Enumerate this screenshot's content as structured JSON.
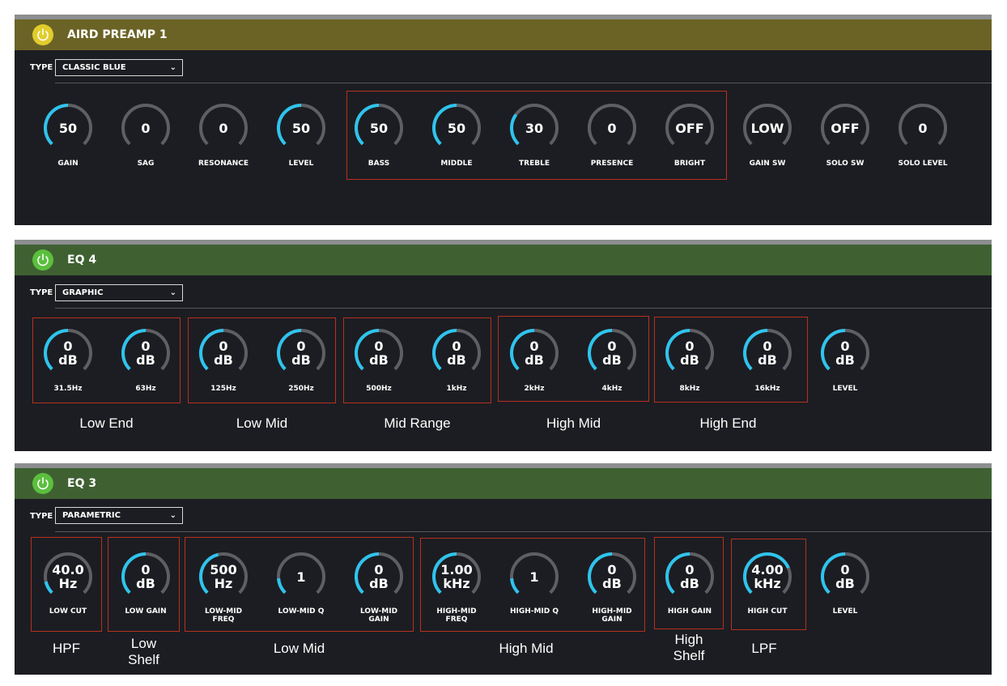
{
  "colors": {
    "panel_bg": "#1c1d22",
    "arc_track": "#5e5f63",
    "arc_value": "#2ec4ee",
    "group_border": "#b5301f",
    "preamp_header": "#6b6325",
    "eq_header": "#3f6132",
    "preamp_power": "#e2cc2c",
    "eq_power": "#5bbf3d"
  },
  "panels": [
    {
      "title": "AIRD PREAMP 1",
      "type_label": "TYPE",
      "type_value": "CLASSIC BLUE",
      "power_icon": "power-icon",
      "knobs": [
        {
          "value": "50",
          "label": "GAIN",
          "level": 0.5
        },
        {
          "value": "0",
          "label": "SAG",
          "level": 0.0
        },
        {
          "value": "0",
          "label": "RESONANCE",
          "level": 0.0
        },
        {
          "value": "50",
          "label": "LEVEL",
          "level": 0.5
        },
        {
          "value": "50",
          "label": "BASS",
          "level": 0.5
        },
        {
          "value": "50",
          "label": "MIDDLE",
          "level": 0.5
        },
        {
          "value": "30",
          "label": "TREBLE",
          "level": 0.3
        },
        {
          "value": "0",
          "label": "PRESENCE",
          "level": 0.0
        },
        {
          "value": "OFF",
          "label": "BRIGHT",
          "level": 0.0
        },
        {
          "value": "LOW",
          "label": "GAIN SW",
          "level": 0.0
        },
        {
          "value": "OFF",
          "label": "SOLO SW",
          "level": 0.0
        },
        {
          "value": "0",
          "label": "SOLO LEVEL",
          "level": 0.0
        }
      ],
      "groups": []
    },
    {
      "title": "EQ 4",
      "type_label": "TYPE",
      "type_value": "GRAPHIC",
      "power_icon": "power-icon",
      "knobs": [
        {
          "value": "0\ndB",
          "label": "31.5Hz",
          "level": 0.5
        },
        {
          "value": "0\ndB",
          "label": "63Hz",
          "level": 0.5
        },
        {
          "value": "0\ndB",
          "label": "125Hz",
          "level": 0.5
        },
        {
          "value": "0\ndB",
          "label": "250Hz",
          "level": 0.5
        },
        {
          "value": "0\ndB",
          "label": "500Hz",
          "level": 0.5
        },
        {
          "value": "0\ndB",
          "label": "1kHz",
          "level": 0.5
        },
        {
          "value": "0\ndB",
          "label": "2kHz",
          "level": 0.5
        },
        {
          "value": "0\ndB",
          "label": "4kHz",
          "level": 0.5
        },
        {
          "value": "0\ndB",
          "label": "8kHz",
          "level": 0.5
        },
        {
          "value": "0\ndB",
          "label": "16kHz",
          "level": 0.5
        },
        {
          "value": "0\ndB",
          "label": "LEVEL",
          "level": 0.5
        }
      ],
      "groups": [
        "Low End",
        "Low Mid",
        "Mid Range",
        "High Mid",
        "High End"
      ]
    },
    {
      "title": "EQ 3",
      "type_label": "TYPE",
      "type_value": "PARAMETRIC",
      "power_icon": "power-icon",
      "knobs": [
        {
          "value": "40.0\nHz",
          "label": "LOW CUT",
          "level": 0.12
        },
        {
          "value": "0\ndB",
          "label": "LOW GAIN",
          "level": 0.5
        },
        {
          "value": "500\nHz",
          "label": "LOW-MID\nFREQ",
          "level": 0.45
        },
        {
          "value": "1",
          "label": "LOW-MID Q",
          "level": 0.15
        },
        {
          "value": "0\ndB",
          "label": "LOW-MID\nGAIN",
          "level": 0.5
        },
        {
          "value": "1.00\nkHz",
          "label": "HIGH-MID\nFREQ",
          "level": 0.5
        },
        {
          "value": "1",
          "label": "HIGH-MID Q",
          "level": 0.15
        },
        {
          "value": "0\ndB",
          "label": "HIGH-MID\nGAIN",
          "level": 0.5
        },
        {
          "value": "0\ndB",
          "label": "HIGH GAIN",
          "level": 0.5
        },
        {
          "value": "4.00\nkHz",
          "label": "HIGH CUT",
          "level": 0.75
        },
        {
          "value": "0\ndB",
          "label": "LEVEL",
          "level": 0.5
        }
      ],
      "groups": [
        "HPF",
        "Low\nShelf",
        "Low Mid",
        "High Mid",
        "High\nShelf",
        "LPF"
      ]
    }
  ]
}
